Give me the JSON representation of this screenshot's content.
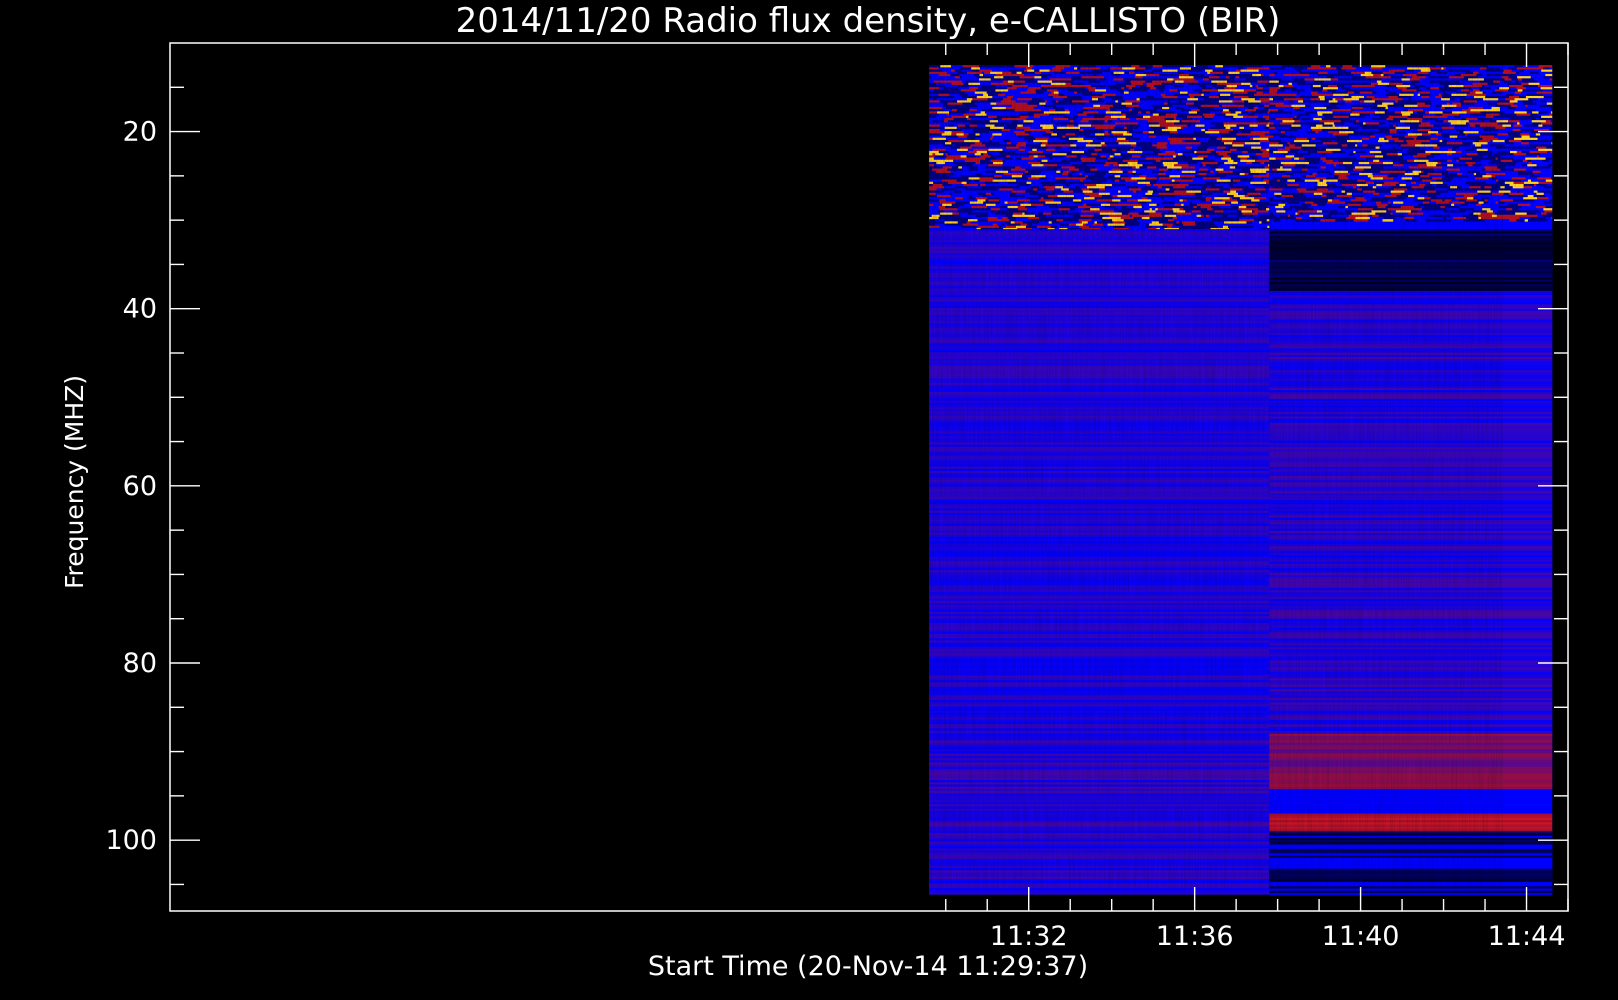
{
  "chart_data": {
    "type": "heatmap",
    "title": "2014/11/20  Radio flux density, e-CALLISTO (BIR)",
    "xlabel": "Start Time (20-Nov-14 11:29:37)",
    "ylabel": "Frequency (MHZ)",
    "x_range_minutes": [
      11.3,
      45.0
    ],
    "ylim": [
      10,
      108
    ],
    "y_inverted": true,
    "x_tick_labels": [
      "11:32",
      "11:36",
      "11:40",
      "11:44"
    ],
    "x_tick_values_minutes": [
      32,
      36,
      40,
      44
    ],
    "y_tick_labels": [
      "20",
      "40",
      "60",
      "80",
      "100"
    ],
    "y_tick_values": [
      20,
      40,
      60,
      80,
      100
    ],
    "data_x_range_minutes": [
      29.6,
      44.62
    ],
    "data_y_range": [
      12.5,
      106
    ],
    "receiver_switch_time_minutes": 37.8,
    "colors": {
      "background": "#000000",
      "axes": "#ffffff",
      "low": "#0000ff",
      "mid": "#b01020",
      "high": "#ffd020"
    },
    "bands": [
      {
        "region": "pre-switch",
        "freq_range": [
          12.5,
          31
        ],
        "level": "high-variable"
      },
      {
        "region": "pre-switch",
        "freq_range": [
          31,
          88
        ],
        "level": "low-uniform"
      },
      {
        "region": "pre-switch",
        "freq_range": [
          88,
          106
        ],
        "level": "low-striped"
      },
      {
        "region": "post-switch",
        "freq_range": [
          12.5,
          30
        ],
        "level": "high-variable"
      },
      {
        "region": "post-switch",
        "freq_range": [
          31,
          38
        ],
        "level": "very-low"
      },
      {
        "region": "post-switch",
        "freq_range": [
          38,
          88
        ],
        "level": "low-striped"
      },
      {
        "region": "post-switch",
        "freq_range": [
          88,
          94
        ],
        "level": "mid"
      },
      {
        "region": "post-switch",
        "freq_range": [
          97,
          99
        ],
        "level": "high"
      },
      {
        "region": "post-switch",
        "freq_range": [
          99,
          106
        ],
        "level": "very-low-striped"
      }
    ]
  }
}
